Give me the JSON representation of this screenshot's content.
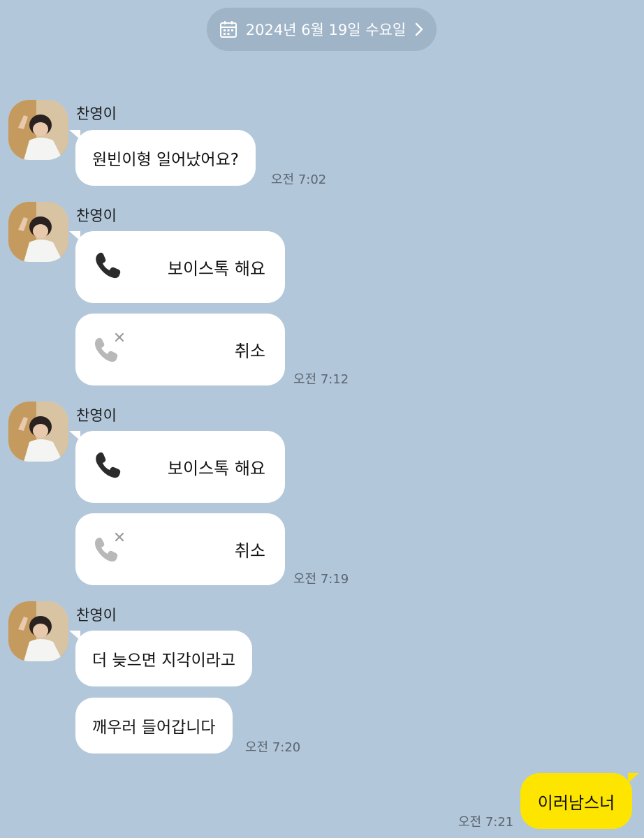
{
  "date_bar": {
    "label": "2024년 6월 19일 수요일",
    "icon": "calendar-icon",
    "chevron": "chevron-right-icon"
  },
  "colors": {
    "background": "#b2c7da",
    "bubble_other": "#ffffff",
    "bubble_mine": "#fee500",
    "pill": "#9fb4c7"
  },
  "groups": [
    {
      "sender": "찬영이",
      "messages": [
        {
          "type": "text",
          "text": "원빈이형 일어났어요?"
        }
      ],
      "time": "오전 7:02"
    },
    {
      "sender": "찬영이",
      "messages": [
        {
          "type": "call",
          "label": "보이스톡 해요",
          "icon": "phone-icon"
        },
        {
          "type": "call",
          "label": "취소",
          "icon": "missed-call-icon"
        }
      ],
      "time": "오전 7:12"
    },
    {
      "sender": "찬영이",
      "messages": [
        {
          "type": "call",
          "label": "보이스톡 해요",
          "icon": "phone-icon"
        },
        {
          "type": "call",
          "label": "취소",
          "icon": "missed-call-icon"
        }
      ],
      "time": "오전 7:19"
    },
    {
      "sender": "찬영이",
      "messages": [
        {
          "type": "text",
          "text": "더 늦으면 지각이라고"
        },
        {
          "type": "text",
          "text": "깨우러 들어갑니다"
        }
      ],
      "time": "오전 7:20"
    }
  ],
  "my_message": {
    "text": "이러남스너",
    "time": "오전 7:21"
  }
}
